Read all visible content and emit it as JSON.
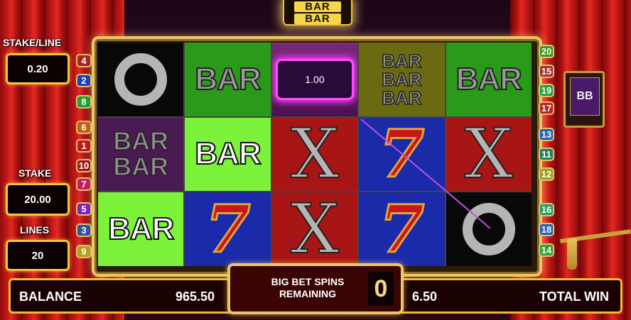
{
  "top_logo": {
    "line1": "BAR",
    "line2": "BAR"
  },
  "stake_line": {
    "label": "STAKE/LINE",
    "value": "0.20"
  },
  "stake": {
    "label": "STAKE",
    "value": "20.00"
  },
  "lines": {
    "label": "LINES",
    "value": "20"
  },
  "win_highlight": {
    "value": "1.00"
  },
  "big_bet": {
    "text": "BIG BET SPINS REMAINING",
    "count": "0"
  },
  "balance": {
    "label": "BALANCE",
    "value": "965.50"
  },
  "total_win": {
    "label": "TOTAL WIN",
    "value": "6.50"
  },
  "side_button": {
    "icon": "big-bet-logo-icon",
    "text": "BB"
  },
  "symbols": {
    "bar": "BAR",
    "x": "X",
    "seven": "7"
  },
  "paylines_left": [
    "4",
    "2",
    "8",
    "6",
    "1",
    "10",
    "7",
    "5",
    "3",
    "9"
  ],
  "paylines_right": [
    "20",
    "15",
    "19",
    "17",
    "13",
    "11",
    "12",
    "16",
    "18",
    "14"
  ],
  "colors": {
    "gold": "#f6c43a",
    "curtain": "#c41818",
    "highlight": "#ff4cff"
  }
}
